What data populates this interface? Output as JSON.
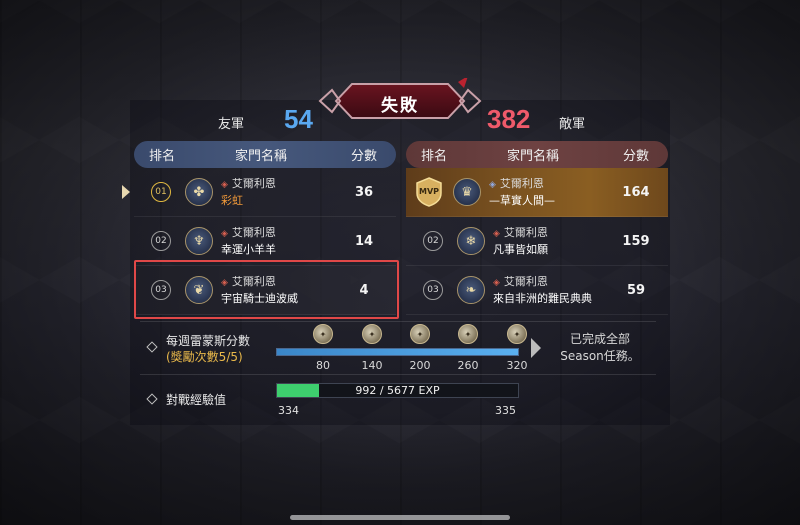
{
  "header": {
    "result": "失敗",
    "ally_label": "友軍",
    "ally_score": "54",
    "enemy_label": "敵軍",
    "enemy_score": "382"
  },
  "table_headers": {
    "rank": "排名",
    "name": "家門名稱",
    "score": "分數"
  },
  "ally_rows": [
    {
      "rank": "01",
      "family": "艾爾利恩",
      "character": "彩虹",
      "score": "36",
      "emblem": "clover-emblem"
    },
    {
      "rank": "02",
      "family": "艾爾利恩",
      "character": "幸運小羊羊",
      "score": "14",
      "emblem": "wings-emblem"
    },
    {
      "rank": "03",
      "family": "艾爾利恩",
      "character": "宇宙騎士迪波威",
      "score": "4",
      "emblem": "wheat-emblem"
    }
  ],
  "enemy_rows": [
    {
      "rank": "MVP",
      "family": "艾爾利恩",
      "character": "—草實人間—",
      "score": "164",
      "emblem": "crown-emblem"
    },
    {
      "rank": "02",
      "family": "艾爾利恩",
      "character": "凡事皆如願",
      "score": "159",
      "emblem": "snowflake-emblem"
    },
    {
      "rank": "03",
      "family": "艾爾利恩",
      "character": "來自非洲的難民典典",
      "score": "59",
      "emblem": "leaf-emblem"
    }
  ],
  "weekly": {
    "label": "每週雷蒙斯分數",
    "sub": "(獎勵次數5/5)",
    "ticks": [
      "80",
      "140",
      "200",
      "260",
      "320"
    ],
    "progress": 1.0,
    "complete_line1": "已完成全部",
    "complete_line2": "Season任務。"
  },
  "exp": {
    "label": "對戰經驗值",
    "value_text": "992 / 5677 EXP",
    "progress": 0.1747,
    "level_from": "334",
    "level_to": "335"
  },
  "colors": {
    "ally_score": "#5aa8f0",
    "enemy_score": "#ef5a6a",
    "exp_fill": "#3ecf6e",
    "highlight": "#e04848",
    "mvp_row": "#7a5220"
  }
}
